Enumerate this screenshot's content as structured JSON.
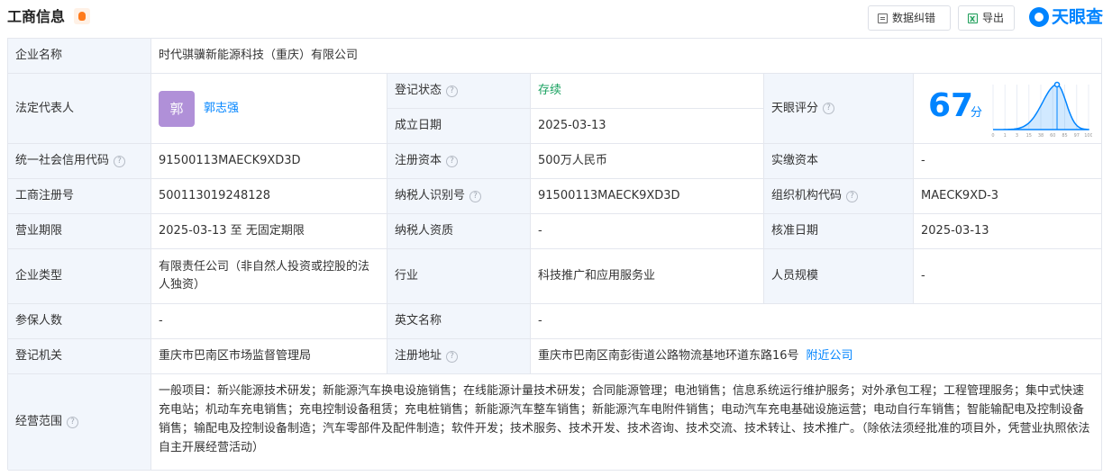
{
  "header": {
    "title": "工商信息",
    "correct_label": "数据纠错",
    "export_label": "导出",
    "brand": "天眼查"
  },
  "company_name": {
    "label": "企业名称",
    "value": "时代骐骥新能源科技（重庆）有限公司"
  },
  "legal_rep": {
    "label": "法定代表人",
    "avatar": "郭",
    "name": "郭志强"
  },
  "reg_status": {
    "label": "登记状态",
    "value": "存续"
  },
  "founded": {
    "label": "成立日期",
    "value": "2025-03-13"
  },
  "score": {
    "label": "天眼评分",
    "value": "67",
    "unit": "分",
    "ticks": [
      "0",
      "1",
      "3",
      "15",
      "38",
      "60",
      "85",
      "97",
      "100"
    ],
    "marker_fraction": 0.67
  },
  "credit_code": {
    "label": "统一社会信用代码",
    "value": "91500113MAECK9XD3D"
  },
  "reg_capital": {
    "label": "注册资本",
    "value": "500万人民币"
  },
  "paid_capital": {
    "label": "实缴资本",
    "value": "-"
  },
  "biz_reg_no": {
    "label": "工商注册号",
    "value": "500113019248128"
  },
  "taxpayer_id": {
    "label": "纳税人识别号",
    "value": "91500113MAECK9XD3D"
  },
  "org_code": {
    "label": "组织机构代码",
    "value": "MAECK9XD-3"
  },
  "term": {
    "label": "营业期限",
    "value": "2025-03-13 至 无固定期限"
  },
  "taxpayer_qual": {
    "label": "纳税人资质",
    "value": "-"
  },
  "approve_date": {
    "label": "核准日期",
    "value": "2025-03-13"
  },
  "company_type": {
    "label": "企业类型",
    "value": "有限责任公司（非自然人投资或控股的法人独资）"
  },
  "industry": {
    "label": "行业",
    "value": "科技推广和应用服务业"
  },
  "staff_size": {
    "label": "人员规模",
    "value": "-"
  },
  "insured": {
    "label": "参保人数",
    "value": "-"
  },
  "english_name": {
    "label": "英文名称",
    "value": "-"
  },
  "authority": {
    "label": "登记机关",
    "value": "重庆市巴南区市场监督管理局"
  },
  "address": {
    "label": "注册地址",
    "value": "重庆市巴南区南彭街道公路物流基地环道东路16号",
    "nearby": "附近公司"
  },
  "scope": {
    "label": "经营范围",
    "value": "一般项目：新兴能源技术研发；新能源汽车换电设施销售；在线能源计量技术研发；合同能源管理；电池销售；信息系统运行维护服务；对外承包工程；工程管理服务；集中式快速充电站；机动车充电销售；充电控制设备租赁；充电桩销售；新能源汽车整车销售；新能源汽车电附件销售；电动汽车充电基础设施运营；电动自行车销售；智能输配电及控制设备销售；输配电及控制设备制造；汽车零部件及配件制造；软件开发；技术服务、技术开发、技术咨询、技术交流、技术转让、技术推广。（除依法须经批准的项目外，凭营业执照依法自主开展经营活动）"
  },
  "help_glyph": "?",
  "colors": {
    "accent": "#0084ff",
    "status_green": "#1aa260",
    "label_bg": "#f2f6fc"
  }
}
